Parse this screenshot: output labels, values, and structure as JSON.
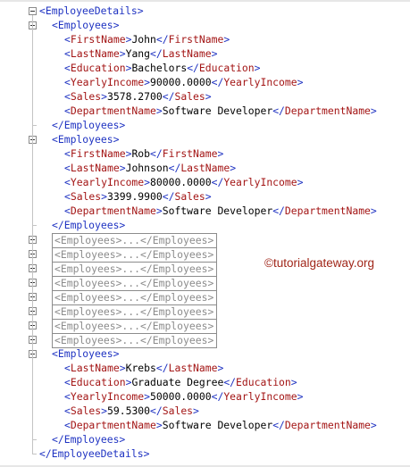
{
  "watermark": "©tutorialgateway.org",
  "root": {
    "open": "<EmployeeDetails>",
    "close": "</EmployeeDetails>"
  },
  "records": [
    {
      "open": "<Employees>",
      "close": "</Employees>",
      "fields": [
        {
          "tag": "FirstName",
          "value": "John"
        },
        {
          "tag": "LastName",
          "value": "Yang"
        },
        {
          "tag": "Education",
          "value": "Bachelors"
        },
        {
          "tag": "YearlyIncome",
          "value": "90000.0000"
        },
        {
          "tag": "Sales",
          "value": "3578.2700"
        },
        {
          "tag": "DepartmentName",
          "value": "Software Developer"
        }
      ]
    },
    {
      "open": "<Employees>",
      "close": "</Employees>",
      "fields": [
        {
          "tag": "FirstName",
          "value": "Rob"
        },
        {
          "tag": "LastName",
          "value": "Johnson"
        },
        {
          "tag": "YearlyIncome",
          "value": "80000.0000"
        },
        {
          "tag": "Sales",
          "value": "3399.9900"
        },
        {
          "tag": "DepartmentName",
          "value": "Software Developer"
        }
      ]
    },
    {
      "open": "<Employees>",
      "close": "</Employees>",
      "fields": [
        {
          "tag": "LastName",
          "value": "Krebs"
        },
        {
          "tag": "Education",
          "value": "Graduate Degree"
        },
        {
          "tag": "YearlyIncome",
          "value": "50000.0000"
        },
        {
          "tag": "Sales",
          "value": "59.5300"
        },
        {
          "tag": "DepartmentName",
          "value": "Software Developer"
        }
      ]
    }
  ],
  "collapsed": [
    "<Employees>...</Employees>",
    "<Employees>...</Employees>",
    "<Employees>...</Employees>",
    "<Employees>...</Employees>",
    "<Employees>...</Employees>",
    "<Employees>...</Employees>",
    "<Employees>...</Employees>",
    "<Employees>...</Employees>"
  ]
}
